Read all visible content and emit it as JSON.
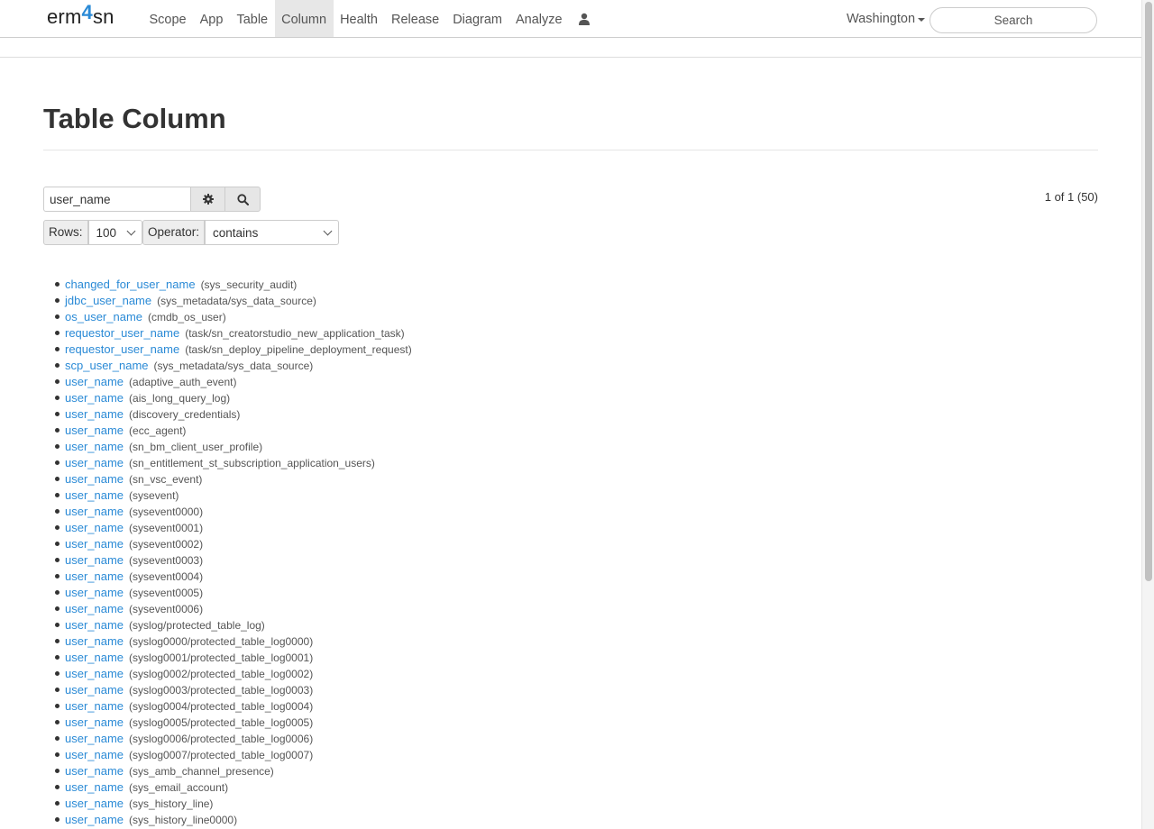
{
  "nav": {
    "brand_prefix": "erm",
    "brand_four": "4",
    "brand_suffix": "sn",
    "items": [
      "Scope",
      "App",
      "Table",
      "Column",
      "Health",
      "Release",
      "Diagram",
      "Analyze"
    ],
    "active": "Column",
    "instance": "Washington",
    "search_placeholder": "Search"
  },
  "page": {
    "title": "Table Column",
    "filter_value": "user_name",
    "pager": "1 of 1 (50)",
    "rows_label": "Rows:",
    "rows_value": "100",
    "operator_label": "Operator:",
    "operator_value": "contains"
  },
  "results": [
    {
      "column": "changed_for_user_name",
      "table": "(sys_security_audit)"
    },
    {
      "column": "jdbc_user_name",
      "table": "(sys_metadata/sys_data_source)"
    },
    {
      "column": "os_user_name",
      "table": "(cmdb_os_user)"
    },
    {
      "column": "requestor_user_name",
      "table": "(task/sn_creatorstudio_new_application_task)"
    },
    {
      "column": "requestor_user_name",
      "table": "(task/sn_deploy_pipeline_deployment_request)"
    },
    {
      "column": "scp_user_name",
      "table": "(sys_metadata/sys_data_source)"
    },
    {
      "column": "user_name",
      "table": "(adaptive_auth_event)"
    },
    {
      "column": "user_name",
      "table": "(ais_long_query_log)"
    },
    {
      "column": "user_name",
      "table": "(discovery_credentials)"
    },
    {
      "column": "user_name",
      "table": "(ecc_agent)"
    },
    {
      "column": "user_name",
      "table": "(sn_bm_client_user_profile)"
    },
    {
      "column": "user_name",
      "table": "(sn_entitlement_st_subscription_application_users)"
    },
    {
      "column": "user_name",
      "table": "(sn_vsc_event)"
    },
    {
      "column": "user_name",
      "table": "(sysevent)"
    },
    {
      "column": "user_name",
      "table": "(sysevent0000)"
    },
    {
      "column": "user_name",
      "table": "(sysevent0001)"
    },
    {
      "column": "user_name",
      "table": "(sysevent0002)"
    },
    {
      "column": "user_name",
      "table": "(sysevent0003)"
    },
    {
      "column": "user_name",
      "table": "(sysevent0004)"
    },
    {
      "column": "user_name",
      "table": "(sysevent0005)"
    },
    {
      "column": "user_name",
      "table": "(sysevent0006)"
    },
    {
      "column": "user_name",
      "table": "(syslog/protected_table_log)"
    },
    {
      "column": "user_name",
      "table": "(syslog0000/protected_table_log0000)"
    },
    {
      "column": "user_name",
      "table": "(syslog0001/protected_table_log0001)"
    },
    {
      "column": "user_name",
      "table": "(syslog0002/protected_table_log0002)"
    },
    {
      "column": "user_name",
      "table": "(syslog0003/protected_table_log0003)"
    },
    {
      "column": "user_name",
      "table": "(syslog0004/protected_table_log0004)"
    },
    {
      "column": "user_name",
      "table": "(syslog0005/protected_table_log0005)"
    },
    {
      "column": "user_name",
      "table": "(syslog0006/protected_table_log0006)"
    },
    {
      "column": "user_name",
      "table": "(syslog0007/protected_table_log0007)"
    },
    {
      "column": "user_name",
      "table": "(sys_amb_channel_presence)"
    },
    {
      "column": "user_name",
      "table": "(sys_email_account)"
    },
    {
      "column": "user_name",
      "table": "(sys_history_line)"
    },
    {
      "column": "user_name",
      "table": "(sys_history_line0000)"
    }
  ]
}
